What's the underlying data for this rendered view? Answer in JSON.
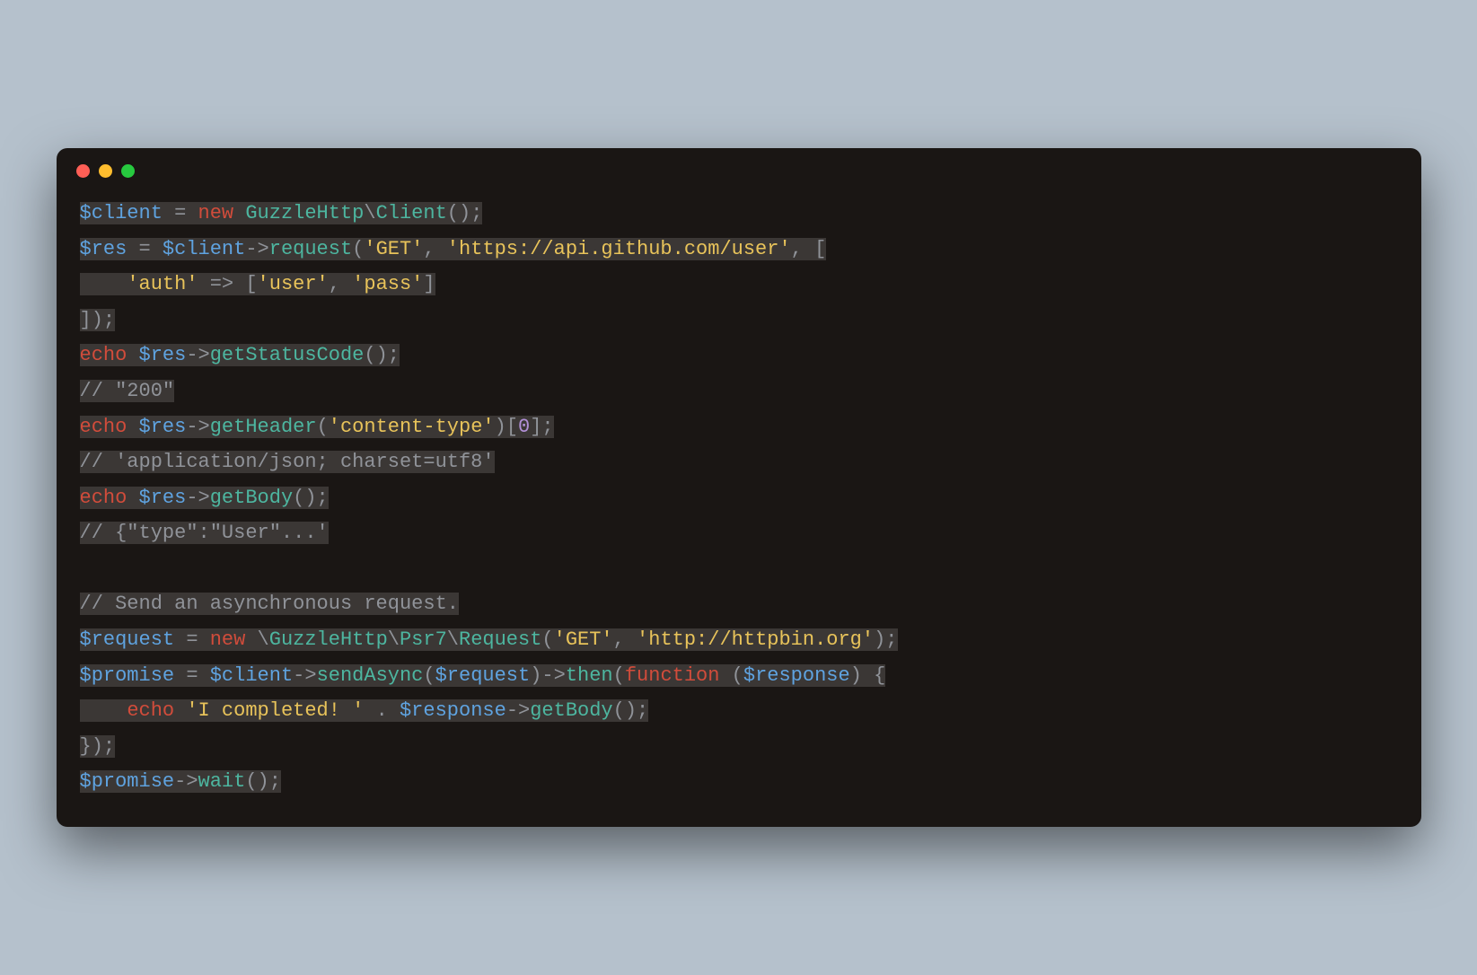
{
  "code": {
    "tokens": [
      [
        {
          "t": "$client",
          "c": "tok-var"
        },
        {
          "t": " ",
          "c": "tok-op"
        },
        {
          "t": "=",
          "c": "tok-op"
        },
        {
          "t": " ",
          "c": "tok-op"
        },
        {
          "t": "new",
          "c": "tok-keyword"
        },
        {
          "t": " ",
          "c": "tok-op"
        },
        {
          "t": "GuzzleHttp",
          "c": "tok-class"
        },
        {
          "t": "\\",
          "c": "tok-punct"
        },
        {
          "t": "Client",
          "c": "tok-class"
        },
        {
          "t": "();",
          "c": "tok-punct"
        }
      ],
      [
        {
          "t": "$res",
          "c": "tok-var"
        },
        {
          "t": " ",
          "c": "tok-op"
        },
        {
          "t": "=",
          "c": "tok-op"
        },
        {
          "t": " ",
          "c": "tok-op"
        },
        {
          "t": "$client",
          "c": "tok-var"
        },
        {
          "t": "->",
          "c": "tok-punct"
        },
        {
          "t": "request",
          "c": "tok-func"
        },
        {
          "t": "(",
          "c": "tok-punct"
        },
        {
          "t": "'GET'",
          "c": "tok-string"
        },
        {
          "t": ", ",
          "c": "tok-punct"
        },
        {
          "t": "'https://api.github.com/user'",
          "c": "tok-string"
        },
        {
          "t": ", [",
          "c": "tok-punct"
        }
      ],
      [
        {
          "t": "    ",
          "c": "tok-op"
        },
        {
          "t": "'auth'",
          "c": "tok-string"
        },
        {
          "t": " ",
          "c": "tok-op"
        },
        {
          "t": "=>",
          "c": "tok-op"
        },
        {
          "t": " [",
          "c": "tok-punct"
        },
        {
          "t": "'user'",
          "c": "tok-string"
        },
        {
          "t": ", ",
          "c": "tok-punct"
        },
        {
          "t": "'pass'",
          "c": "tok-string"
        },
        {
          "t": "]",
          "c": "tok-punct"
        }
      ],
      [
        {
          "t": "]);",
          "c": "tok-punct"
        }
      ],
      [
        {
          "t": "echo",
          "c": "tok-echo"
        },
        {
          "t": " ",
          "c": "tok-op"
        },
        {
          "t": "$res",
          "c": "tok-var"
        },
        {
          "t": "->",
          "c": "tok-punct"
        },
        {
          "t": "getStatusCode",
          "c": "tok-func"
        },
        {
          "t": "();",
          "c": "tok-punct"
        }
      ],
      [
        {
          "t": "// \"200\"",
          "c": "tok-comment"
        }
      ],
      [
        {
          "t": "echo",
          "c": "tok-echo"
        },
        {
          "t": " ",
          "c": "tok-op"
        },
        {
          "t": "$res",
          "c": "tok-var"
        },
        {
          "t": "->",
          "c": "tok-punct"
        },
        {
          "t": "getHeader",
          "c": "tok-func"
        },
        {
          "t": "(",
          "c": "tok-punct"
        },
        {
          "t": "'content-type'",
          "c": "tok-string"
        },
        {
          "t": ")[",
          "c": "tok-punct"
        },
        {
          "t": "0",
          "c": "tok-number"
        },
        {
          "t": "];",
          "c": "tok-punct"
        }
      ],
      [
        {
          "t": "// 'application/json; charset=utf8'",
          "c": "tok-comment"
        }
      ],
      [
        {
          "t": "echo",
          "c": "tok-echo"
        },
        {
          "t": " ",
          "c": "tok-op"
        },
        {
          "t": "$res",
          "c": "tok-var"
        },
        {
          "t": "->",
          "c": "tok-punct"
        },
        {
          "t": "getBody",
          "c": "tok-func"
        },
        {
          "t": "();",
          "c": "tok-punct"
        }
      ],
      [
        {
          "t": "// {\"type\":\"User\"...'",
          "c": "tok-comment"
        }
      ],
      [
        {
          "t": "",
          "c": "tok-op"
        }
      ],
      [
        {
          "t": "// Send an asynchronous request.",
          "c": "tok-comment"
        }
      ],
      [
        {
          "t": "$request",
          "c": "tok-var"
        },
        {
          "t": " ",
          "c": "tok-op"
        },
        {
          "t": "=",
          "c": "tok-op"
        },
        {
          "t": " ",
          "c": "tok-op"
        },
        {
          "t": "new",
          "c": "tok-keyword"
        },
        {
          "t": " \\",
          "c": "tok-punct"
        },
        {
          "t": "GuzzleHttp",
          "c": "tok-class"
        },
        {
          "t": "\\",
          "c": "tok-punct"
        },
        {
          "t": "Psr7",
          "c": "tok-class"
        },
        {
          "t": "\\",
          "c": "tok-punct"
        },
        {
          "t": "Request",
          "c": "tok-class"
        },
        {
          "t": "(",
          "c": "tok-punct"
        },
        {
          "t": "'GET'",
          "c": "tok-string"
        },
        {
          "t": ", ",
          "c": "tok-punct"
        },
        {
          "t": "'http://httpbin.org'",
          "c": "tok-string"
        },
        {
          "t": ");",
          "c": "tok-punct"
        }
      ],
      [
        {
          "t": "$promise",
          "c": "tok-var"
        },
        {
          "t": " ",
          "c": "tok-op"
        },
        {
          "t": "=",
          "c": "tok-op"
        },
        {
          "t": " ",
          "c": "tok-op"
        },
        {
          "t": "$client",
          "c": "tok-var"
        },
        {
          "t": "->",
          "c": "tok-punct"
        },
        {
          "t": "sendAsync",
          "c": "tok-func"
        },
        {
          "t": "(",
          "c": "tok-punct"
        },
        {
          "t": "$request",
          "c": "tok-var"
        },
        {
          "t": ")",
          "c": "tok-punct"
        },
        {
          "t": "->",
          "c": "tok-punct"
        },
        {
          "t": "then",
          "c": "tok-func"
        },
        {
          "t": "(",
          "c": "tok-punct"
        },
        {
          "t": "function",
          "c": "tok-keyword"
        },
        {
          "t": " (",
          "c": "tok-punct"
        },
        {
          "t": "$response",
          "c": "tok-var"
        },
        {
          "t": ") {",
          "c": "tok-punct"
        }
      ],
      [
        {
          "t": "    ",
          "c": "tok-op"
        },
        {
          "t": "echo",
          "c": "tok-echo"
        },
        {
          "t": " ",
          "c": "tok-op"
        },
        {
          "t": "'I completed! '",
          "c": "tok-string"
        },
        {
          "t": " . ",
          "c": "tok-punct"
        },
        {
          "t": "$response",
          "c": "tok-var"
        },
        {
          "t": "->",
          "c": "tok-punct"
        },
        {
          "t": "getBody",
          "c": "tok-func"
        },
        {
          "t": "();",
          "c": "tok-punct"
        }
      ],
      [
        {
          "t": "});",
          "c": "tok-punct"
        }
      ],
      [
        {
          "t": "$promise",
          "c": "tok-var"
        },
        {
          "t": "->",
          "c": "tok-punct"
        },
        {
          "t": "wait",
          "c": "tok-func"
        },
        {
          "t": "();",
          "c": "tok-punct"
        }
      ]
    ]
  }
}
